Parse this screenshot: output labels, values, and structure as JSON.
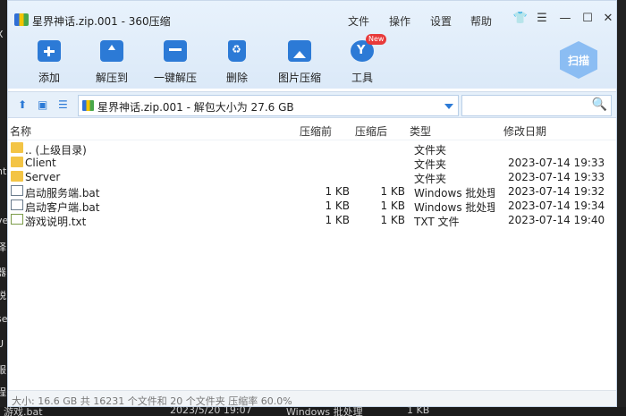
{
  "window": {
    "title": "星界神话.zip.001 - 360压缩",
    "menu": [
      "文件",
      "操作",
      "设置",
      "帮助"
    ],
    "title_icons": [
      "shirt-icon",
      "menu-icon",
      "minimize-icon",
      "maximize-icon",
      "close-icon"
    ]
  },
  "toolbar": {
    "items": [
      {
        "label": "添加",
        "icon": "add-icon"
      },
      {
        "label": "解压到",
        "icon": "extract-icon"
      },
      {
        "label": "一键解压",
        "icon": "one-key-extract-icon"
      },
      {
        "label": "删除",
        "icon": "delete-icon"
      },
      {
        "label": "图片压缩",
        "icon": "image-compress-icon"
      },
      {
        "label": "工具",
        "icon": "tools-icon"
      }
    ],
    "new_badge": "New",
    "scan_label": "扫描"
  },
  "address": {
    "path": "星界神话.zip.001 - 解包大小为 27.6 GB",
    "search_placeholder": ""
  },
  "columns": [
    "名称",
    "压缩前",
    "压缩后",
    "类型",
    "修改日期"
  ],
  "files": [
    {
      "name": ".. (上级目录)",
      "compressed": "",
      "original": "",
      "type": "文件夹",
      "date": "",
      "icon": "folder-icon"
    },
    {
      "name": "Client",
      "compressed": "",
      "original": "",
      "type": "文件夹",
      "date": "2023-07-14 19:33",
      "icon": "folder-icon"
    },
    {
      "name": "Server",
      "compressed": "",
      "original": "",
      "type": "文件夹",
      "date": "2023-07-14 19:33",
      "icon": "folder-icon"
    },
    {
      "name": "启动服务端.bat",
      "compressed": "1 KB",
      "original": "1 KB",
      "type": "Windows 批处理...",
      "date": "2023-07-14 19:32",
      "icon": "bat-file-icon"
    },
    {
      "name": "启动客户端.bat",
      "compressed": "1 KB",
      "original": "1 KB",
      "type": "Windows 批处理...",
      "date": "2023-07-14 19:34",
      "icon": "bat-file-icon"
    },
    {
      "name": "游戏说明.txt",
      "compressed": "1 KB",
      "original": "1 KB",
      "type": "TXT 文件",
      "date": "2023-07-14 19:40",
      "icon": "txt-file-icon"
    }
  ],
  "status": "大小: 16.6 GB 共 16231 个文件和 20 个文件夹 压缩率 60.0%",
  "background": {
    "left_fragments": [
      "X",
      "nt",
      "ve",
      "译",
      "器",
      "锐",
      "se",
      "U",
      "服",
      "程",
      "源"
    ],
    "bottom_fragments": [
      "游戏.bat",
      "2023/5/20 19:07",
      "Windows 批处理",
      "1 KB"
    ]
  }
}
